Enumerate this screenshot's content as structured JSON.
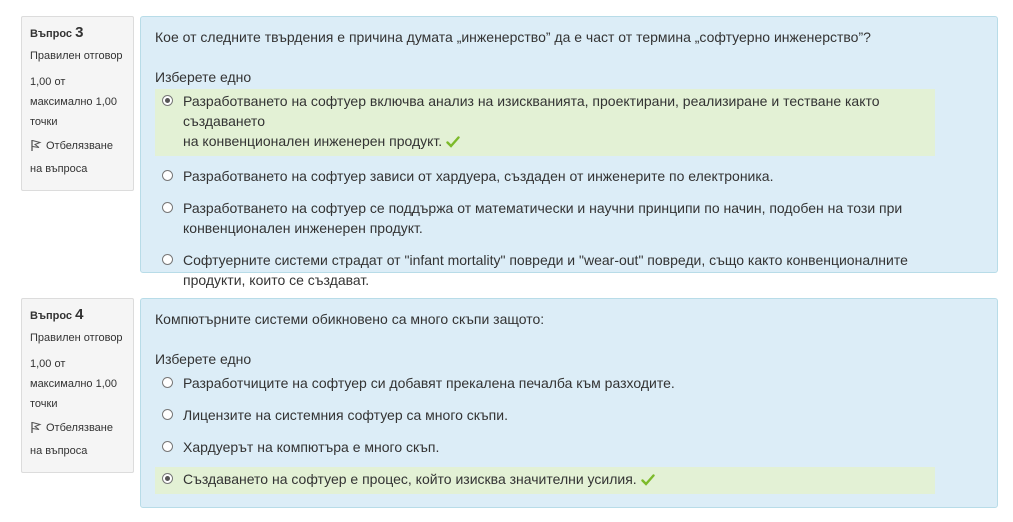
{
  "questions": [
    {
      "label": "Въпрос",
      "number": "3",
      "state": "Правилен отговор",
      "grade_line1": "1,00 от",
      "grade_line2": "максимално 1,00",
      "grade_line3": "точки",
      "flag_line1": "Отбелязване",
      "flag_line2": "на въпроса",
      "text": "Кое от следните твърдения е причина думата „инженерство” да е част от термина „софтуерно инженерство”?",
      "prompt": "Изберете едно",
      "answers": [
        {
          "line1": "Разработването на софтуер включва анализ на изискванията, проектирани, реализиране и тестване както създаването",
          "line2": "на конвенционален инженерен продукт.",
          "checked": true,
          "correct": true
        },
        {
          "line1": "Разработването на софтуер зависи от хардуера, създаден от инженерите по електроника.",
          "line2": "",
          "checked": false,
          "correct": false
        },
        {
          "line1": "Разработването на софтуер се поддържа от математически и научни принципи по начин, подобен на този при",
          "line2": "конвенционален инженерен продукт.",
          "checked": false,
          "correct": false
        },
        {
          "line1": "Софтуерните системи страдат от \"infant mortality\" повреди и \"wear-out\" повреди, също както конвенционалните",
          "line2": "продукти, които се създават.",
          "checked": false,
          "correct": false
        }
      ]
    },
    {
      "label": "Въпрос",
      "number": "4",
      "state": "Правилен отговор",
      "grade_line1": "1,00 от",
      "grade_line2": "максимално 1,00",
      "grade_line3": "точки",
      "flag_line1": "Отбелязване",
      "flag_line2": "на въпроса",
      "text": "Компютърните системи обикновено са много скъпи защото:",
      "prompt": "Изберете едно",
      "answers": [
        {
          "line1": "Разработчиците на софтуер си добавят прекалена печалба към разходите.",
          "line2": "",
          "checked": false,
          "correct": false
        },
        {
          "line1": "Лицензите на системния софтуер са много скъпи.",
          "line2": "",
          "checked": false,
          "correct": false
        },
        {
          "line1": "Хардуерът на компютъра е много скъп.",
          "line2": "",
          "checked": false,
          "correct": false
        },
        {
          "line1": "Създаването на софтуер е процес, който изисква значителни усилия.",
          "line2": "",
          "checked": true,
          "correct": true
        }
      ]
    }
  ],
  "colors": {
    "accent_check": "#7cba2a",
    "correct_bg": "#e3f1d5",
    "content_bg": "#dcedf7"
  }
}
